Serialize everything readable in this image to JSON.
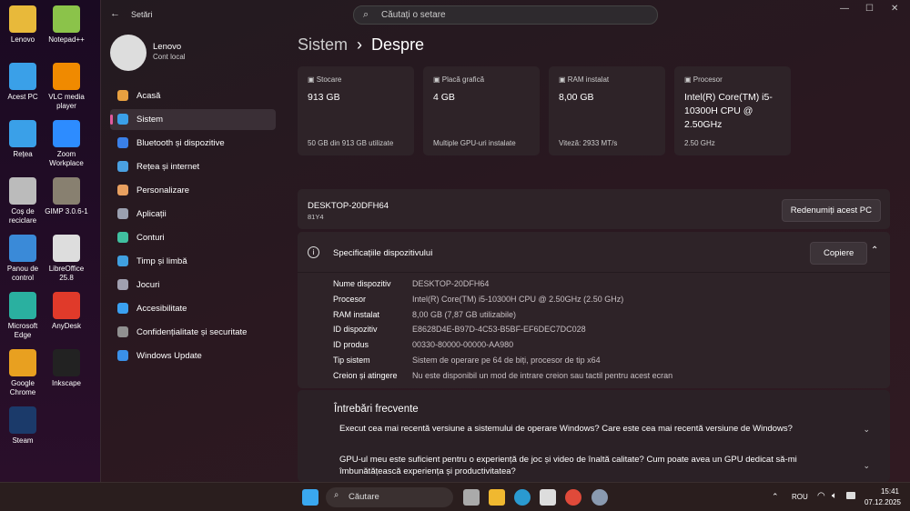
{
  "desktop": [
    {
      "label": "Lenovo",
      "color": "#e8b93a"
    },
    {
      "label": "Notepad++",
      "color": "#8bc34a"
    },
    {
      "label": "Acest PC",
      "color": "#3aa0e8"
    },
    {
      "label": "VLC media player",
      "color": "#f08a00"
    },
    {
      "label": "Rețea",
      "color": "#3aa0e8"
    },
    {
      "label": "Zoom Workplace",
      "color": "#2d8cff"
    },
    {
      "label": "Coș de reciclare",
      "color": "#bbbbbb"
    },
    {
      "label": "GIMP 3.0.6-1",
      "color": "#888070"
    },
    {
      "label": "Panou de control",
      "color": "#3a8ad8"
    },
    {
      "label": "LibreOffice 25.8",
      "color": "#dddddd"
    },
    {
      "label": "Microsoft Edge",
      "color": "#2ab0a0"
    },
    {
      "label": "AnyDesk",
      "color": "#e03a2a"
    },
    {
      "label": "Google Chrome",
      "color": "#e8a020"
    },
    {
      "label": "Inkscape",
      "color": "#222222"
    },
    {
      "label": "Steam",
      "color": "#1b3a6a"
    }
  ],
  "window": {
    "title": "Setări",
    "search_placeholder": "Căutați o setare"
  },
  "user": {
    "name": "Lenovo",
    "account": "Cont local"
  },
  "nav": [
    {
      "label": "Acasă",
      "color": "#e8a040"
    },
    {
      "label": "Sistem",
      "color": "#3aa0e8"
    },
    {
      "label": "Bluetooth și dispozitive",
      "color": "#3a80e8"
    },
    {
      "label": "Rețea și internet",
      "color": "#4aa0e0"
    },
    {
      "label": "Personalizare",
      "color": "#e8a060"
    },
    {
      "label": "Aplicații",
      "color": "#9aa0b0"
    },
    {
      "label": "Conturi",
      "color": "#40c0a0"
    },
    {
      "label": "Timp și limbă",
      "color": "#40a0e0"
    },
    {
      "label": "Jocuri",
      "color": "#a0a0b0"
    },
    {
      "label": "Accesibilitate",
      "color": "#3aa0f0"
    },
    {
      "label": "Confidențialitate și securitate",
      "color": "#909090"
    },
    {
      "label": "Windows Update",
      "color": "#3a90e8"
    }
  ],
  "breadcrumb": {
    "parent": "Sistem",
    "sep": "›",
    "current": "Despre"
  },
  "cards": [
    {
      "label": "Stocare",
      "value": "913 GB",
      "sub": "50 GB din 913 GB utilizate"
    },
    {
      "label": "Placă grafică",
      "value": "4 GB",
      "sub": "Multiple GPU-uri instalate"
    },
    {
      "label": "RAM instalat",
      "value": "8,00 GB",
      "sub": "Viteză: 2933 MT/s"
    },
    {
      "label": "Procesor",
      "value": "Intel(R) Core(TM) i5-10300H CPU @ 2.50GHz",
      "sub": "2.50 GHz"
    }
  ],
  "device": {
    "name": "DESKTOP-20DFH64",
    "model": "81Y4",
    "rename": "Redenumiți acest PC"
  },
  "specs": {
    "title": "Specificațiile dispozitivului",
    "copy": "Copiere",
    "rows": [
      {
        "k": "Nume dispozitiv",
        "v": "DESKTOP-20DFH64"
      },
      {
        "k": "Procesor",
        "v": "Intel(R) Core(TM) i5-10300H CPU @ 2.50GHz (2.50 GHz)"
      },
      {
        "k": "RAM instalat",
        "v": "8,00 GB (7,87 GB utilizabile)"
      },
      {
        "k": "ID dispozitiv",
        "v": "E8628D4E-B97D-4C53-B5BF-EF6DEC7DC028"
      },
      {
        "k": "ID produs",
        "v": "00330-80000-00000-AA980"
      },
      {
        "k": "Tip sistem",
        "v": "Sistem de operare pe 64 de biți, procesor de tip x64"
      },
      {
        "k": "Creion și atingere",
        "v": "Nu este disponibil un mod de intrare creion sau tactil pentru acest ecran"
      }
    ]
  },
  "faq": {
    "title": "Întrebări frecvente",
    "items": [
      "Execut cea mai recentă versiune a sistemului de operare Windows? Care este cea mai recentă versiune de Windows?",
      "GPU-ul meu este suficient pentru o experiență de joc și video de înaltă calitate? Cum poate avea un GPU dedicat să-mi îmbunătățească experiența și productivitatea?"
    ]
  },
  "taskbar": {
    "search": "Căutare",
    "lang": "ROU",
    "time": "15:41",
    "date": "07.12.2025"
  }
}
